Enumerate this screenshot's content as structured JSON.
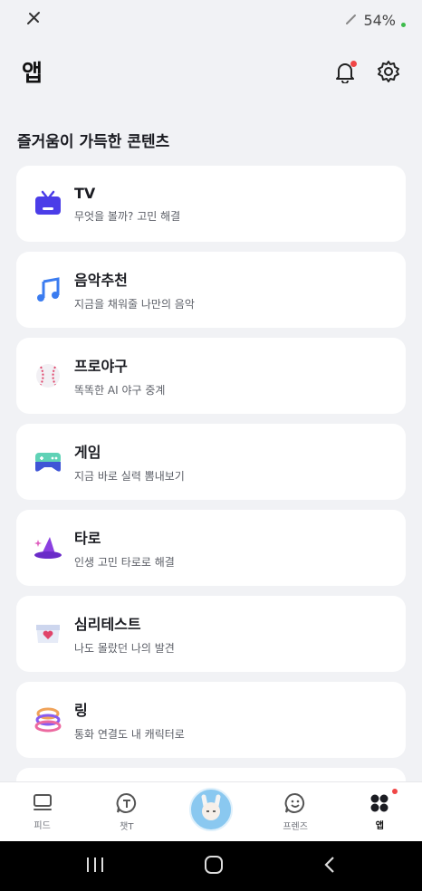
{
  "status_bar": {
    "battery": "54%"
  },
  "header": {
    "title": "앱"
  },
  "section": {
    "title": "즐거움이 가득한 콘텐츠"
  },
  "cards": [
    {
      "title": "TV",
      "subtitle": "무엇을 볼까? 고민 해결",
      "icon": "tv-icon"
    },
    {
      "title": "음악추천",
      "subtitle": "지금을 채워줄 나만의 음악",
      "icon": "music-note-icon"
    },
    {
      "title": "프로야구",
      "subtitle": "똑똑한 AI 야구 중계",
      "icon": "baseball-icon"
    },
    {
      "title": "게임",
      "subtitle": "지금 바로 실력 뽐내보기",
      "icon": "gamepad-icon"
    },
    {
      "title": "타로",
      "subtitle": "인생 고민 타로로 해결",
      "icon": "witch-hat-icon"
    },
    {
      "title": "심리테스트",
      "subtitle": "나도 몰랐던 나의 발견",
      "icon": "psych-test-icon"
    },
    {
      "title": "링",
      "subtitle": "통화 연결도 내 캐릭터로",
      "icon": "ring-icon"
    }
  ],
  "bottom_nav": [
    {
      "label": "피드",
      "icon": "feed-icon"
    },
    {
      "label": "챗T",
      "icon": "chat-t-icon"
    },
    {
      "label": "",
      "icon": "avatar-icon"
    },
    {
      "label": "프렌즈",
      "icon": "friends-icon"
    },
    {
      "label": "앱",
      "icon": "apps-grid-icon"
    }
  ],
  "colors": {
    "accent": "#4b3de8",
    "notification": "#f04646",
    "background": "#f1f2f5"
  }
}
